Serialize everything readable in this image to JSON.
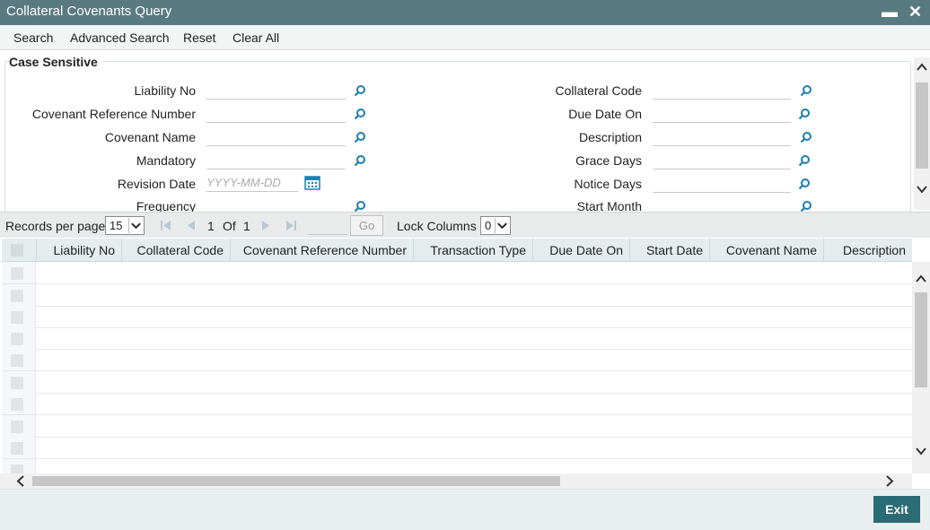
{
  "window": {
    "title": "Collateral Covenants Query",
    "minimize": "▬",
    "close": "✕"
  },
  "menu": {
    "search": "Search",
    "advanced_search": "Advanced Search",
    "reset": "Reset",
    "clear_all": "Clear All"
  },
  "criteria": {
    "legend": "Case Sensitive",
    "left_fields": [
      {
        "label": "Liability No",
        "value": "",
        "has_lookup": true
      },
      {
        "label": "Covenant Reference Number",
        "value": "",
        "has_lookup": true
      },
      {
        "label": "Covenant Name",
        "value": "",
        "has_lookup": true
      },
      {
        "label": "Mandatory",
        "value": "",
        "has_lookup": true
      },
      {
        "label": "Revision Date",
        "value": "",
        "placeholder": "YYYY-MM-DD",
        "has_calendar": true
      },
      {
        "label": "Frequency",
        "value": "",
        "has_lookup": true
      }
    ],
    "right_fields": [
      {
        "label": "Collateral Code",
        "value": ""
      },
      {
        "label": "Due Date On",
        "value": ""
      },
      {
        "label": "Description",
        "value": ""
      },
      {
        "label": "Grace Days",
        "value": ""
      },
      {
        "label": "Notice Days",
        "value": ""
      },
      {
        "label": "Start Month",
        "value": ""
      }
    ]
  },
  "pager": {
    "records_per_page_label": "Records per page",
    "records_per_page": "15",
    "current_page": "1",
    "of_label": "Of",
    "total_pages": "1",
    "go_label": "Go",
    "lock_columns_label": "Lock Columns",
    "lock_columns": "0"
  },
  "grid": {
    "columns": [
      "Liability No",
      "Collateral Code",
      "Covenant Reference Number",
      "Transaction Type",
      "Due Date On",
      "Start Date",
      "Covenant Name",
      "Description"
    ],
    "rows": []
  },
  "footer": {
    "exit_label": "Exit"
  },
  "colors": {
    "titlebar": "#5a7a82",
    "accent": "#2a6b75",
    "lookup_icon": "#1d7fb0"
  }
}
